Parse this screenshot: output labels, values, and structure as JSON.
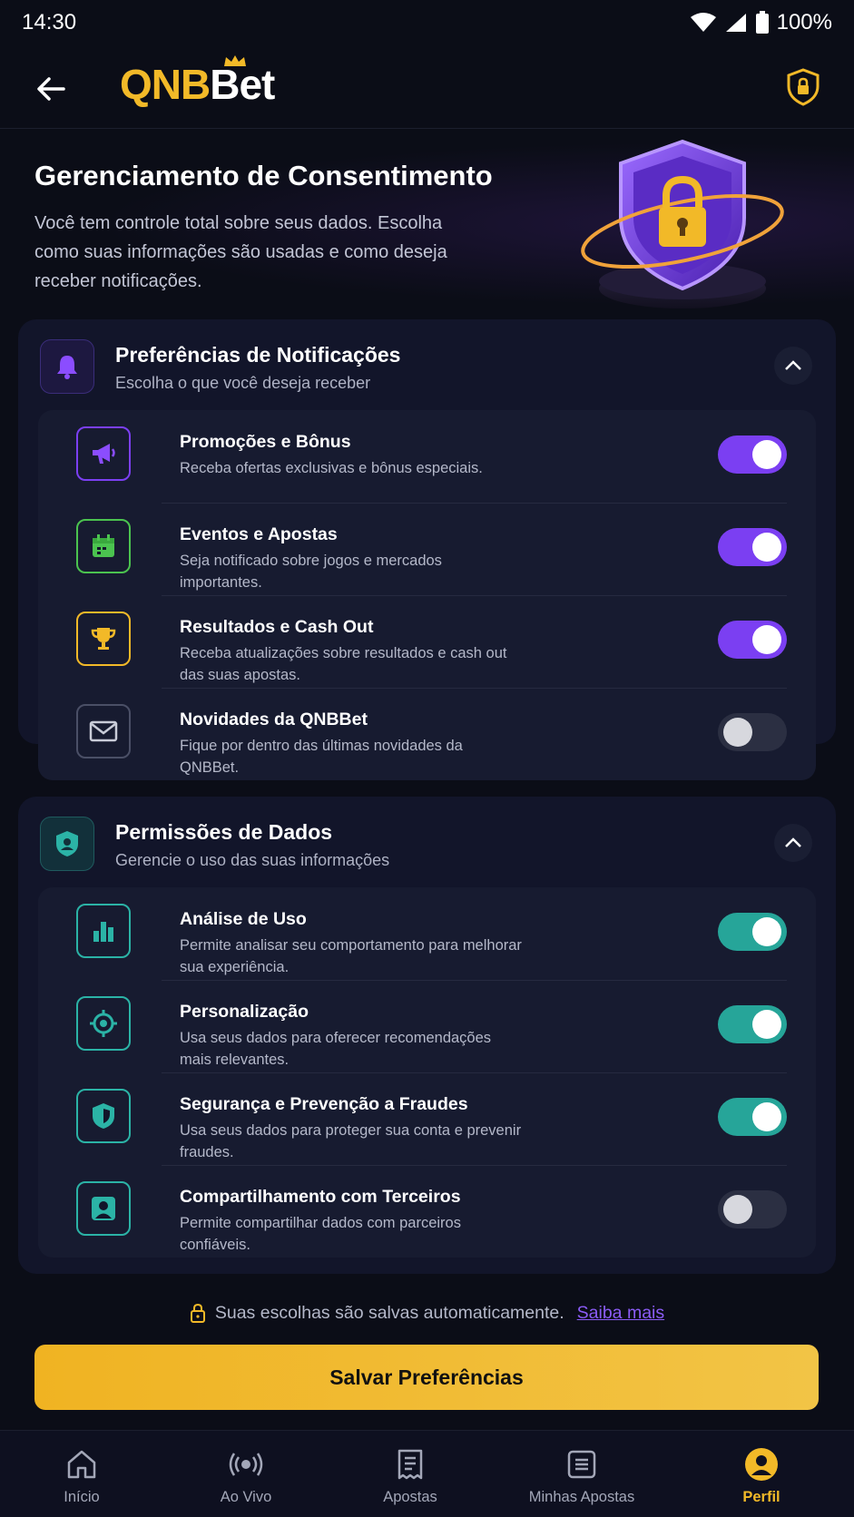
{
  "status_bar": {
    "time": "14:30",
    "battery": "100%"
  },
  "app_bar": {
    "logo_left": "QNB",
    "logo_right": "Bet"
  },
  "hero": {
    "title": "Gerenciamento de Consentimento",
    "description": "Você tem controle total sobre seus dados. Escolha como suas informações são usadas e como deseja receber notificações."
  },
  "notifications": {
    "title": "Preferências de Notificações",
    "subtitle": "Escolha o que você deseja receber",
    "items": [
      {
        "title": "Promoções e Bônus",
        "desc": "Receba ofertas exclusivas e bônus especiais.",
        "enabled": true,
        "icon": "megaphone-icon"
      },
      {
        "title": "Eventos e Apostas",
        "desc": "Seja notificado sobre jogos e mercados importantes.",
        "enabled": true,
        "icon": "calendar-icon"
      },
      {
        "title": "Resultados e Cash Out",
        "desc": "Receba atualizações sobre resultados e cash out das suas apostas.",
        "enabled": true,
        "icon": "trophy-icon"
      },
      {
        "title": "Novidades da QNBBet",
        "desc": "Fique por dentro das últimas novidades da QNBBet.",
        "enabled": false,
        "icon": "mail-icon"
      }
    ]
  },
  "permissions": {
    "title": "Permissões de Dados",
    "subtitle": "Gerencie o uso das suas informações",
    "items": [
      {
        "title": "Análise de Uso",
        "desc": "Permite analisar seu comportamento para melhorar sua experiência.",
        "enabled": true,
        "icon": "bar-chart-icon"
      },
      {
        "title": "Personalização",
        "desc": "Usa seus dados para oferecer recomendações mais relevantes.",
        "enabled": true,
        "icon": "target-icon"
      },
      {
        "title": "Segurança e Prevenção a Fraudes",
        "desc": "Usa seus dados para proteger sua conta e prevenir fraudes.",
        "enabled": true,
        "icon": "shield-icon"
      },
      {
        "title": "Compartilhamento com Terceiros",
        "desc": "Permite compartilhar dados com parceiros confiáveis.",
        "enabled": false,
        "icon": "user-icon"
      }
    ]
  },
  "footer": {
    "note": "Suas escolhas são salvas automaticamente.",
    "learn_more": "Saiba mais",
    "save_button": "Salvar Preferências"
  },
  "bottom_nav": {
    "items": [
      {
        "label": "Início",
        "icon": "home-icon"
      },
      {
        "label": "Ao Vivo",
        "icon": "live-icon"
      },
      {
        "label": "Apostas",
        "icon": "bet-slip-icon"
      },
      {
        "label": "Minhas Apostas",
        "icon": "my-bets-icon"
      },
      {
        "label": "Perfil",
        "icon": "profile-icon"
      }
    ],
    "active": "Perfil"
  },
  "colors": {
    "accent_gold": "#f2b928",
    "toggle_purple": "#7b3ff2",
    "toggle_teal": "#26a599",
    "background": "#0b0d17"
  }
}
